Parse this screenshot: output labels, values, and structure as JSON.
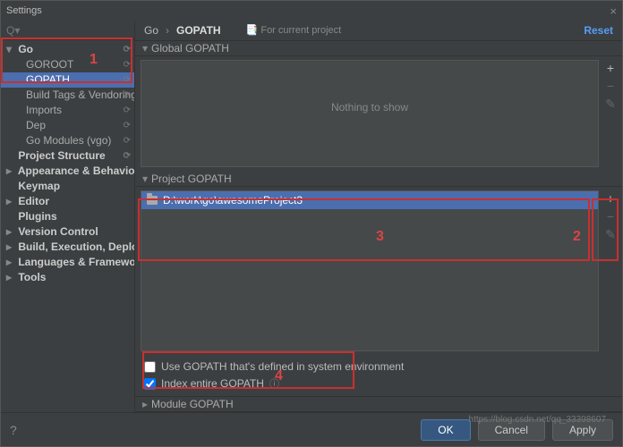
{
  "window": {
    "title": "Settings",
    "close_icon": "×"
  },
  "search": {
    "placeholder": "Q▾"
  },
  "sidebar": {
    "go": {
      "label": "Go",
      "items": [
        {
          "label": "GOROOT"
        },
        {
          "label": "GOPATH"
        },
        {
          "label": "Build Tags & Vendoring"
        },
        {
          "label": "Imports"
        },
        {
          "label": "Dep"
        },
        {
          "label": "Go Modules (vgo)"
        }
      ]
    },
    "top": [
      {
        "label": "Project Structure"
      },
      {
        "label": "Appearance & Behavior",
        "expandable": true
      },
      {
        "label": "Keymap"
      },
      {
        "label": "Editor",
        "expandable": true
      },
      {
        "label": "Plugins"
      },
      {
        "label": "Version Control",
        "expandable": true
      },
      {
        "label": "Build, Execution, Deployment",
        "expandable": true
      },
      {
        "label": "Languages & Frameworks",
        "expandable": true
      },
      {
        "label": "Tools",
        "expandable": true
      }
    ]
  },
  "crumb": {
    "a": "Go",
    "sep": "›",
    "b": "GOPATH",
    "for": "For current project",
    "reset": "Reset"
  },
  "global": {
    "header": "Global GOPATH",
    "empty": "Nothing to show"
  },
  "project": {
    "header": "Project GOPATH",
    "path": "D:\\work\\go\\awesomeProject3"
  },
  "checks": {
    "use_env": "Use GOPATH that's defined in system environment",
    "index": "Index entire GOPATH"
  },
  "module": {
    "header": "Module GOPATH"
  },
  "buttons": {
    "ok": "OK",
    "cancel": "Cancel",
    "apply": "Apply",
    "help": "?"
  },
  "csdn": "https://blog.csdn.net/qq_33398607",
  "anno": {
    "n1": "1",
    "n2": "2",
    "n3": "3",
    "n4": "4"
  }
}
